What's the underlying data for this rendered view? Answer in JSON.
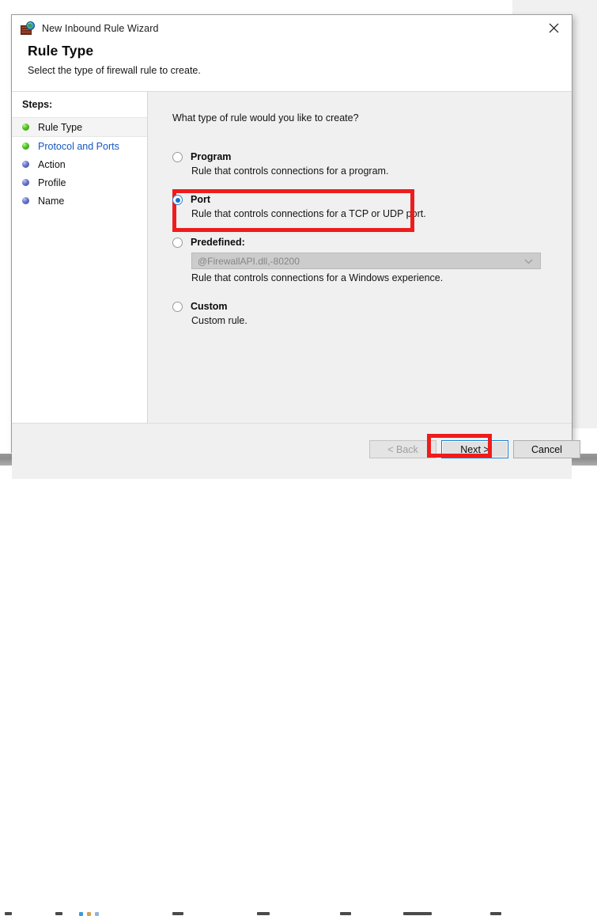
{
  "window": {
    "title": "New Inbound Rule Wizard",
    "icon": "firewall-brickwall-globe-icon",
    "close_label": "✕"
  },
  "header": {
    "title": "Rule Type",
    "subtitle": "Select the type of firewall rule to create."
  },
  "sidebar": {
    "label": "Steps:",
    "items": [
      {
        "label": "Rule Type",
        "state": "current",
        "bullet": "green"
      },
      {
        "label": "Protocol and Ports",
        "state": "link",
        "bullet": "green"
      },
      {
        "label": "Action",
        "state": "pending",
        "bullet": "blue"
      },
      {
        "label": "Profile",
        "state": "pending",
        "bullet": "blue"
      },
      {
        "label": "Name",
        "state": "pending",
        "bullet": "blue"
      }
    ]
  },
  "main": {
    "question": "What type of rule would you like to create?",
    "options": [
      {
        "title": "Program",
        "description": "Rule that controls connections for a program.",
        "selected": false
      },
      {
        "title": "Port",
        "description": "Rule that controls connections for a TCP or UDP port.",
        "selected": true,
        "highlighted": true
      },
      {
        "title": "Predefined:",
        "description": "Rule that controls connections for a Windows experience.",
        "selected": false,
        "dropdown_value": "@FirewallAPI.dll,-80200",
        "dropdown_disabled": true
      },
      {
        "title": "Custom",
        "description": "Custom rule.",
        "selected": false
      }
    ]
  },
  "footer": {
    "back_label": "< Back",
    "back_disabled": true,
    "next_label": "Next >",
    "next_focused": true,
    "next_highlighted": true,
    "cancel_label": "Cancel"
  },
  "colors": {
    "annotation_red": "#ee1c1c",
    "link_blue": "#1457c4",
    "radio_blue": "#1b73c9",
    "bullet_green": "#54c425",
    "bullet_blue": "#6673c9",
    "dialog_bg": "#f0f0f0"
  }
}
